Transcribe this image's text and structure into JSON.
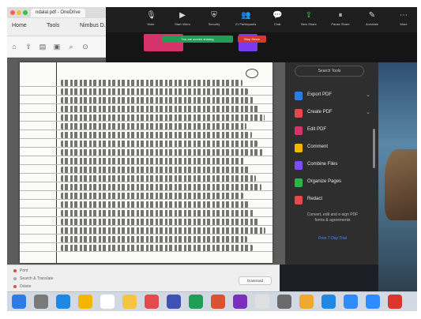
{
  "window": {
    "tab_title": "ndalal.pdf - OneDrive",
    "menu": [
      "Home",
      "Tools",
      "Nimbus D..."
    ]
  },
  "zoom": {
    "toolbar": [
      {
        "name": "unmute",
        "label": "Mute",
        "icon": "mic-icon"
      },
      {
        "name": "video",
        "label": "Start Video",
        "icon": "video-icon"
      },
      {
        "name": "security",
        "label": "Security",
        "icon": "shield-icon"
      },
      {
        "name": "participants",
        "label": "Participants",
        "icon": "people-icon",
        "badge": "21"
      },
      {
        "name": "chat",
        "label": "Chat",
        "icon": "chat-icon"
      },
      {
        "name": "share",
        "label": "New Share",
        "icon": "share-icon"
      },
      {
        "name": "pause",
        "label": "Pause Share",
        "icon": "pause-icon"
      },
      {
        "name": "annotate",
        "label": "Annotate",
        "icon": "pencil-icon"
      },
      {
        "name": "more",
        "label": "More",
        "icon": "more-icon"
      }
    ],
    "share_banner": "You are screen sharing",
    "stop_share": "Stop Share",
    "colors": {
      "share": "#1f9d55",
      "stop": "#d9372e",
      "thumb1": "#d6336c",
      "thumb2": "#7c3aed"
    }
  },
  "tools_pane": {
    "header": "Search Tools",
    "items": [
      {
        "label": "Export PDF",
        "icon": "export-pdf-icon",
        "color": "#2d7be5",
        "chevron": "⌄"
      },
      {
        "label": "Create PDF",
        "icon": "create-pdf-icon",
        "color": "#e5484d",
        "chevron": "⌄"
      },
      {
        "label": "Edit PDF",
        "icon": "edit-pdf-icon",
        "color": "#d6336c",
        "chevron": ""
      },
      {
        "label": "Comment",
        "icon": "comment-icon",
        "color": "#f5b400",
        "chevron": ""
      },
      {
        "label": "Combine Files",
        "icon": "combine-icon",
        "color": "#7c4dff",
        "chevron": ""
      },
      {
        "label": "Organize Pages",
        "icon": "organize-icon",
        "color": "#2fb344",
        "chevron": ""
      },
      {
        "label": "Redact",
        "icon": "redact-icon",
        "color": "#e5484d",
        "chevron": ""
      }
    ],
    "note": "Convert, edit and e-sign PDF forms & agreements",
    "link": "Free 7-Day Trial"
  },
  "panel": {
    "rows": [
      "Print",
      "Search & Translate",
      "Delete"
    ],
    "button": "Download"
  }
}
